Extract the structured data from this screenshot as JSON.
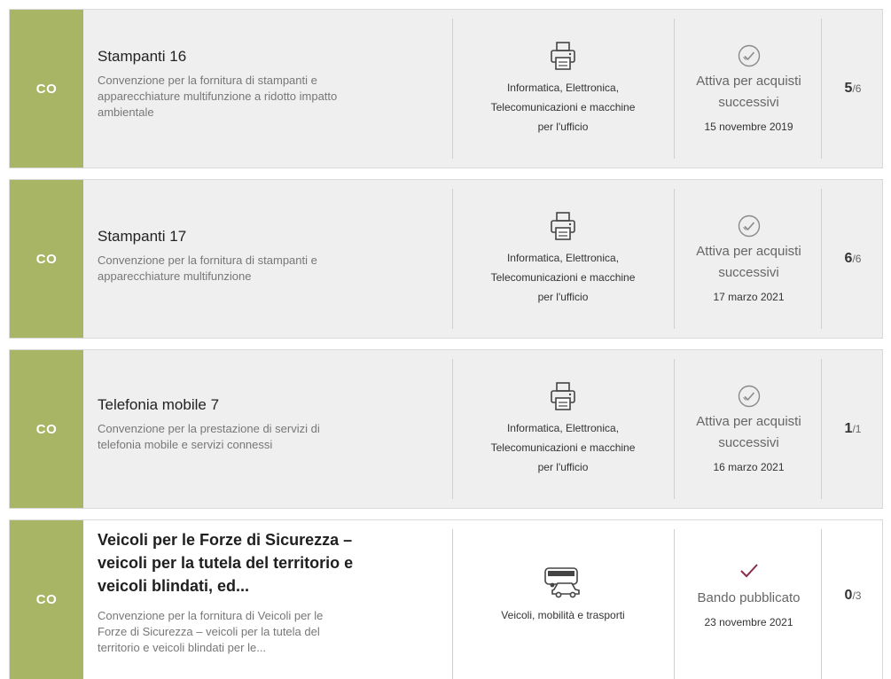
{
  "colors": {
    "tag": "#a7b565",
    "check": "#8b2c4b",
    "card_bg": "#efefef"
  },
  "items": [
    {
      "tag": "CO",
      "title": "Stampanti 16",
      "desc_lines": [
        "Convenzione per la fornitura di stampanti e",
        "apparecchiature multifunzione a ridotto impatto",
        "ambientale"
      ],
      "category_icon": "printer-icon",
      "category_lines": [
        "Informatica, Elettronica,",
        "Telecomunicazioni e macchine",
        "per l'ufficio"
      ],
      "status_icon": "circle-check-icon",
      "status_lines": [
        "Attiva per acquisti",
        "successivi"
      ],
      "date": "15 novembre 2019",
      "count": "5",
      "total": "/6"
    },
    {
      "tag": "CO",
      "title": "Stampanti 17",
      "desc_lines": [
        "Convenzione per la fornitura di stampanti e",
        "apparecchiature multifunzione"
      ],
      "category_icon": "printer-icon",
      "category_lines": [
        "Informatica, Elettronica,",
        "Telecomunicazioni e macchine",
        "per l'ufficio"
      ],
      "status_icon": "circle-check-icon",
      "status_lines": [
        "Attiva per acquisti",
        "successivi"
      ],
      "date": "17 marzo 2021",
      "count": "6",
      "total": "/6"
    },
    {
      "tag": "CO",
      "title": "Telefonia mobile 7",
      "desc_lines": [
        "Convenzione per la prestazione di servizi di",
        "telefonia mobile e servizi connessi"
      ],
      "category_icon": "printer-icon",
      "category_lines": [
        "Informatica, Elettronica,",
        "Telecomunicazioni e macchine",
        "per l'ufficio"
      ],
      "status_icon": "circle-check-icon",
      "status_lines": [
        "Attiva per acquisti",
        "successivi"
      ],
      "date": "16 marzo 2021",
      "count": "1",
      "total": "/1"
    },
    {
      "tag": "CO",
      "title_lines": [
        "Veicoli per le Forze di Sicurezza –",
        "veicoli per la tutela del territorio e",
        "veicoli blindati, ed..."
      ],
      "desc_lines": [
        "Convenzione per la fornitura di Veicoli per le",
        "Forze di Sicurezza – veicoli per la tutela del",
        "territorio e veicoli blindati per le..."
      ],
      "category_icon": "bus-car-icon",
      "category_lines": [
        "Veicoli, mobilità e trasporti"
      ],
      "status_icon": "checkmark-icon",
      "status_lines": [
        "Bando pubblicato"
      ],
      "date": "23 novembre 2021",
      "count": "0",
      "total": "/3"
    }
  ]
}
